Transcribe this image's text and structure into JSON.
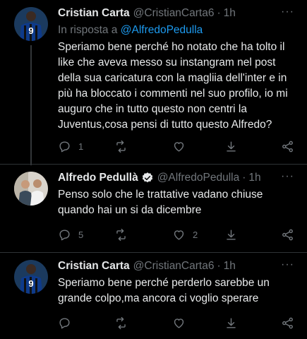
{
  "tweets": [
    {
      "name": "Cristian Carta",
      "handle": "@CristianCarta6",
      "separator": "·",
      "time": "1h",
      "reply_prefix": "In risposta a",
      "reply_mention": "@AlfredoPedulla",
      "text": "Speriamo bene perché ho notato che ha tolto il like che aveva messo su instangram nel post della sua caricatura con la magliia dell'inter e in più ha bloccato i commenti nel suo profilo, io mi auguro che in tutto questo non centri la Juventus,cosa pensi di tutto questo Alfredo?",
      "reply_count": "1",
      "retweet_count": "",
      "like_count": ""
    },
    {
      "name": "Alfredo Pedullà",
      "handle": "@AlfredoPedulla",
      "separator": "·",
      "time": "1h",
      "text": "Penso solo che le trattative vadano chiuse quando hai un si da dicembre",
      "reply_count": "5",
      "retweet_count": "",
      "like_count": "2"
    },
    {
      "name": "Cristian Carta",
      "handle": "@CristianCarta6",
      "separator": "·",
      "time": "1h",
      "text": "Speriamo bene perché perderlo sarebbe un grande colpo,ma ancora ci voglio sperare",
      "reply_count": "",
      "retweet_count": "",
      "like_count": ""
    }
  ],
  "more_label": "···",
  "colors": {
    "accent": "#1d9bf0",
    "muted": "#71767b",
    "background": "#000000"
  }
}
